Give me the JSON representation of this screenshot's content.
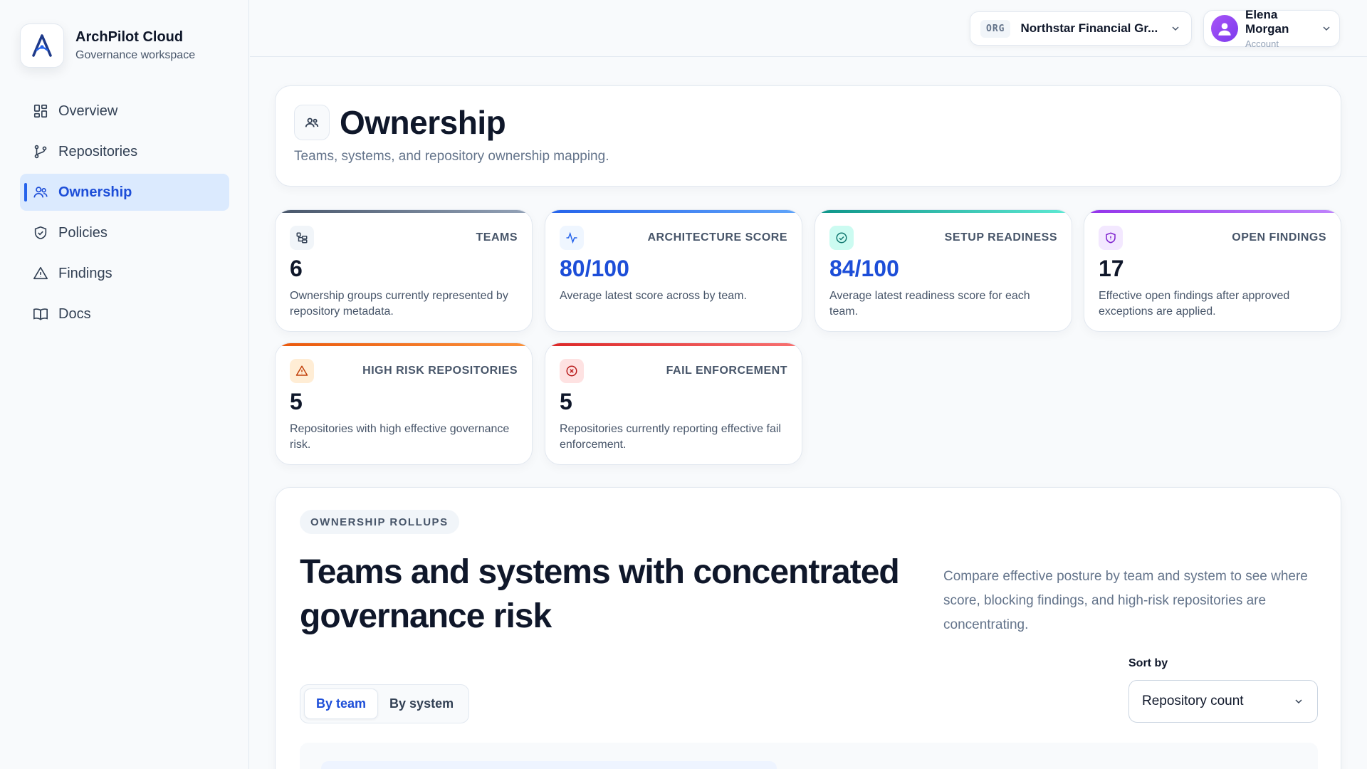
{
  "brand": {
    "title": "ArchPilot Cloud",
    "subtitle": "Governance workspace"
  },
  "sidebar": {
    "items": [
      {
        "label": "Overview",
        "icon": "grid-icon",
        "active": false
      },
      {
        "label": "Repositories",
        "icon": "git-branch-icon",
        "active": false
      },
      {
        "label": "Ownership",
        "icon": "users-icon",
        "active": true
      },
      {
        "label": "Policies",
        "icon": "shield-icon",
        "active": false
      },
      {
        "label": "Findings",
        "icon": "warning-icon",
        "active": false
      },
      {
        "label": "Docs",
        "icon": "book-icon",
        "active": false
      }
    ]
  },
  "topbar": {
    "org_tag": "ORG",
    "org_name": "Northstar Financial Gr...",
    "user_name": "Elena Morgan",
    "user_role": "Account"
  },
  "header": {
    "title": "Ownership",
    "subtitle": "Teams, systems, and repository ownership mapping."
  },
  "metrics": [
    {
      "label": "TEAMS",
      "value": "6",
      "desc": "Ownership groups currently represented by repository metadata.",
      "accent": "#64748b",
      "icon": "org-tree-icon"
    },
    {
      "label": "ARCHITECTURE SCORE",
      "value": "80/100",
      "desc": "Average latest score across by team.",
      "accent": "#2563eb",
      "icon": "activity-icon"
    },
    {
      "label": "SETUP READINESS",
      "value": "84/100",
      "desc": "Average latest readiness score for each team.",
      "accent": "#0d9488",
      "icon": "check-circle-icon"
    },
    {
      "label": "OPEN FINDINGS",
      "value": "17",
      "desc": "Effective open findings after approved exceptions are applied.",
      "accent": "#9333ea",
      "icon": "shield-icon"
    },
    {
      "label": "HIGH RISK REPOSITORIES",
      "value": "5",
      "desc": "Repositories with high effective governance risk.",
      "accent": "#ea580c",
      "icon": "warning-icon"
    },
    {
      "label": "FAIL ENFORCEMENT",
      "value": "5",
      "desc": "Repositories currently reporting effective fail enforcement.",
      "accent": "#dc2626",
      "icon": "x-circle-icon"
    }
  ],
  "rollups": {
    "pill": "OWNERSHIP ROLLUPS",
    "title": "Teams and systems with concentrated governance risk",
    "description": "Compare effective posture by team and system to see where score, blocking findings, and high-risk repositories are concentrating.",
    "tabs": [
      "By team",
      "By system"
    ],
    "active_tab": "By team",
    "sort_label": "Sort by",
    "sort_value": "Repository count"
  }
}
